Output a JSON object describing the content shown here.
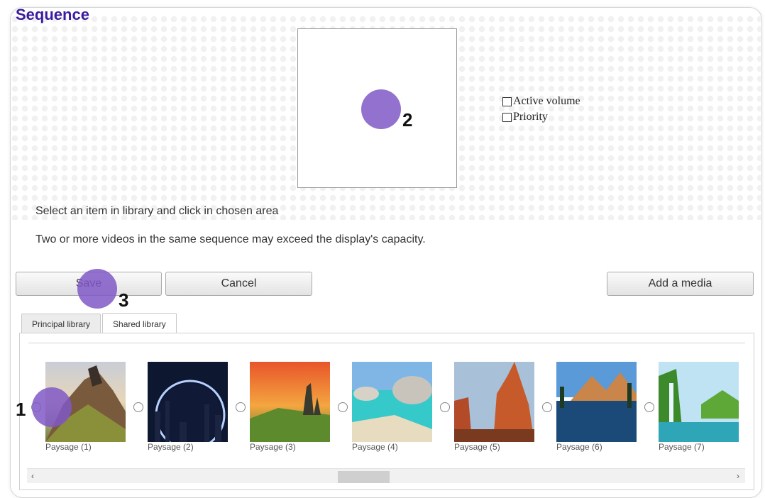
{
  "app": {
    "title": "Sequence"
  },
  "preview": {
    "options": [
      {
        "label": "Active volume",
        "checked": false
      },
      {
        "label": "Priority",
        "checked": false
      }
    ]
  },
  "messages": [
    "Select an item in library and click in chosen area",
    "Two or more videos in the same sequence may exceed the display's capacity."
  ],
  "toolbar": {
    "save_label": "Save",
    "cancel_label": "Cancel",
    "add_media_label": "Add a media"
  },
  "tabs": [
    {
      "label": "Principal library",
      "active": false
    },
    {
      "label": "Shared library",
      "active": true
    }
  ],
  "library": {
    "items": [
      {
        "caption": "Paysage (1)",
        "selected": false
      },
      {
        "caption": "Paysage (2)",
        "selected": false
      },
      {
        "caption": "Paysage (3)",
        "selected": false
      },
      {
        "caption": "Paysage (4)",
        "selected": false
      },
      {
        "caption": "Paysage (5)",
        "selected": false
      },
      {
        "caption": "Paysage (6)",
        "selected": false
      },
      {
        "caption": "Paysage (7)",
        "selected": false
      }
    ]
  },
  "scrollbar": {
    "left_arrow": "‹",
    "right_arrow": "›"
  },
  "annotations": [
    {
      "number": "1",
      "target": "library-item-radio"
    },
    {
      "number": "2",
      "target": "preview-area"
    },
    {
      "number": "3",
      "target": "save-button"
    }
  ],
  "colors": {
    "title": "#3b1c9e",
    "marker": "#8058c6"
  }
}
